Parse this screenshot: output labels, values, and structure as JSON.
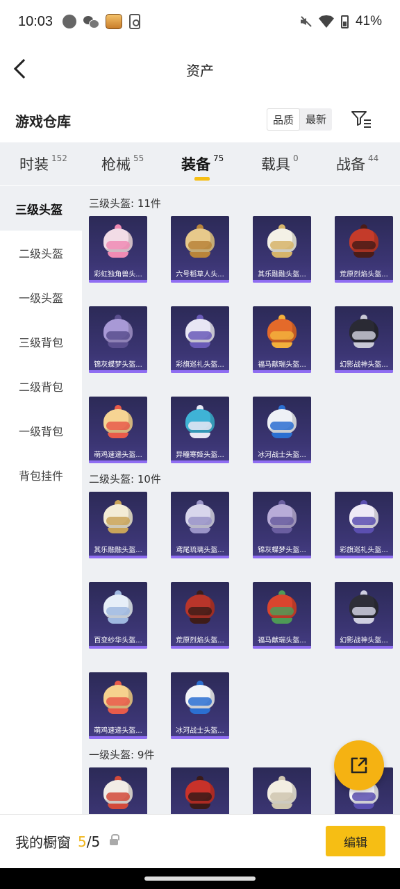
{
  "status_bar": {
    "time": "10:03",
    "battery": "41%",
    "icons": [
      "dot-icon",
      "wechat-icon",
      "game-icon",
      "phone-icon",
      "mute-icon",
      "wifi-icon",
      "battery-icon"
    ]
  },
  "header": {
    "title": "资产",
    "back_icon": "back-arrow-icon"
  },
  "warehouse": {
    "title": "游戏仓库",
    "sort_options": [
      "品质",
      "最新"
    ],
    "filter_icon": "filter-icon"
  },
  "tabs": [
    {
      "label": "时装",
      "count": "152"
    },
    {
      "label": "枪械",
      "count": "55"
    },
    {
      "label": "装备",
      "count": "75",
      "active": true
    },
    {
      "label": "载具",
      "count": "0"
    },
    {
      "label": "战备",
      "count": "44"
    }
  ],
  "side_nav": [
    {
      "label": "三级头盔",
      "active": true
    },
    {
      "label": "二级头盔"
    },
    {
      "label": "一级头盔"
    },
    {
      "label": "三级背包"
    },
    {
      "label": "二级背包"
    },
    {
      "label": "一级背包"
    },
    {
      "label": "背包挂件"
    }
  ],
  "sections": [
    {
      "title": "三级头盔: 11件",
      "items": [
        {
          "name": "彩虹独角兽头...",
          "color": "#f2dce6",
          "accent": "#f08bb4"
        },
        {
          "name": "六号稻草人头...",
          "color": "#e7c98b",
          "accent": "#b9843a"
        },
        {
          "name": "其乐融融头盔...",
          "color": "#f4f1e6",
          "accent": "#d6b46a"
        },
        {
          "name": "荒原烈焰头盔...",
          "color": "#c43b2a",
          "accent": "#4a1c18"
        },
        {
          "name": "锦灰蝶梦头盔...",
          "color": "#a899d6",
          "accent": "#5b4f8f"
        },
        {
          "name": "彩旗巡礼头盔...",
          "color": "#e8e6f4",
          "accent": "#6a5bb8"
        },
        {
          "name": "福马献瑞头盔...",
          "color": "#e46a2a",
          "accent": "#f3b03c"
        },
        {
          "name": "幻影战神头盔...",
          "color": "#2a2a34",
          "accent": "#c9c9d6"
        },
        {
          "name": "萌鸡速递头盔...",
          "color": "#f6d493",
          "accent": "#e85b4a"
        },
        {
          "name": "异瞳寒姬头盔...",
          "color": "#3fb3d6",
          "accent": "#e8e8f4"
        },
        {
          "name": "冰河战士头盔...",
          "color": "#eef1f6",
          "accent": "#2b6fd1"
        }
      ]
    },
    {
      "title": "二级头盔: 10件",
      "items": [
        {
          "name": "其乐融融头盔...",
          "color": "#f3ecd6",
          "accent": "#c9a45a"
        },
        {
          "name": "鸢尾琉璃头盔...",
          "color": "#d8d6ec",
          "accent": "#9a94c8"
        },
        {
          "name": "锦灰蝶梦头盔...",
          "color": "#b8acd8",
          "accent": "#6a5ea0"
        },
        {
          "name": "彩旗巡礼头盔...",
          "color": "#eeeaf6",
          "accent": "#5b4fb0"
        },
        {
          "name": "百变纱华头盔...",
          "color": "#e6eef8",
          "accent": "#9fb8e0"
        },
        {
          "name": "荒原烈焰头盔...",
          "color": "#b8352a",
          "accent": "#3e1c18"
        },
        {
          "name": "福马献瑞头盔...",
          "color": "#d9452e",
          "accent": "#4e9a56"
        },
        {
          "name": "幻影战神头盔...",
          "color": "#2e2e38",
          "accent": "#cfcfe0"
        },
        {
          "name": "萌鸡速递头盔...",
          "color": "#f6d28e",
          "accent": "#e85b4a"
        },
        {
          "name": "冰河战士头盔...",
          "color": "#f2f4f8",
          "accent": "#2b6fd1"
        }
      ]
    },
    {
      "title": "一级头盔: 9件",
      "items": [
        {
          "name": "",
          "color": "#f1ece6",
          "accent": "#d24a3a"
        },
        {
          "name": "",
          "color": "#c8322a",
          "accent": "#3a1a18"
        },
        {
          "name": "",
          "color": "#f3eee2",
          "accent": "#cfc6b0"
        },
        {
          "name": "",
          "color": "#f4f4f8",
          "accent": "#5a4fb0"
        }
      ]
    }
  ],
  "share_button": {
    "icon": "share-icon"
  },
  "bottom_bar": {
    "label": "我的橱窗",
    "count_current": "5",
    "count_total": "/5",
    "lock_icon": "lock-icon",
    "edit_label": "编辑"
  },
  "colors": {
    "accent": "#f6be14",
    "card_bg": "#332f66",
    "rarity": "#8f6df2"
  }
}
